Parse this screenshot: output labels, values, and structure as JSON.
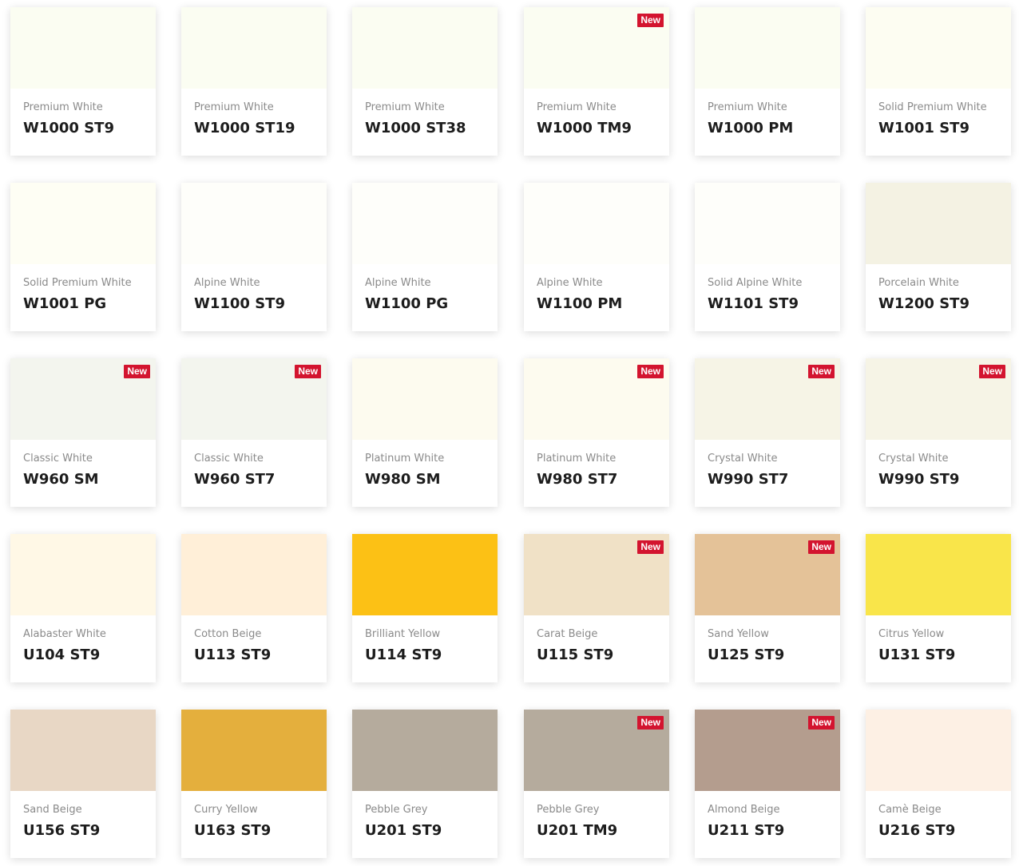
{
  "badge_label": "New",
  "cards": [
    {
      "name": "Premium White",
      "code": "W1000 ST9",
      "color": "#fbfdf2",
      "is_new": false
    },
    {
      "name": "Premium White",
      "code": "W1000 ST19",
      "color": "#fbfdf2",
      "is_new": false
    },
    {
      "name": "Premium White",
      "code": "W1000 ST38",
      "color": "#fbfdf2",
      "is_new": false
    },
    {
      "name": "Premium White",
      "code": "W1000 TM9",
      "color": "#fbfdf2",
      "is_new": true
    },
    {
      "name": "Premium White",
      "code": "W1000 PM",
      "color": "#fbfdf2",
      "is_new": false
    },
    {
      "name": "Solid Premium White",
      "code": "W1001 ST9",
      "color": "#fdfdf2",
      "is_new": false
    },
    {
      "name": "Solid Premium White",
      "code": "W1001 PG",
      "color": "#fefef4",
      "is_new": false
    },
    {
      "name": "Alpine White",
      "code": "W1100 ST9",
      "color": "#fefefa",
      "is_new": false
    },
    {
      "name": "Alpine White",
      "code": "W1100 PG",
      "color": "#fefefa",
      "is_new": false
    },
    {
      "name": "Alpine White",
      "code": "W1100 PM",
      "color": "#fefefa",
      "is_new": false
    },
    {
      "name": "Solid Alpine White",
      "code": "W1101 ST9",
      "color": "#fefefa",
      "is_new": false
    },
    {
      "name": "Porcelain White",
      "code": "W1200 ST9",
      "color": "#f4f2e3",
      "is_new": false
    },
    {
      "name": "Classic White",
      "code": "W960 SM",
      "color": "#f3f5ee",
      "is_new": true
    },
    {
      "name": "Classic White",
      "code": "W960 ST7",
      "color": "#f3f5ee",
      "is_new": true
    },
    {
      "name": "Platinum White",
      "code": "W980 SM",
      "color": "#fdfbef",
      "is_new": false
    },
    {
      "name": "Platinum White",
      "code": "W980 ST7",
      "color": "#fdfbef",
      "is_new": true
    },
    {
      "name": "Crystal White",
      "code": "W990 ST7",
      "color": "#f6f4e6",
      "is_new": true
    },
    {
      "name": "Crystal White",
      "code": "W990 ST9",
      "color": "#f6f4e6",
      "is_new": true
    },
    {
      "name": "Alabaster White",
      "code": "U104 ST9",
      "color": "#fff8e6",
      "is_new": false
    },
    {
      "name": "Cotton Beige",
      "code": "U113 ST9",
      "color": "#ffefd8",
      "is_new": false
    },
    {
      "name": "Brilliant Yellow",
      "code": "U114 ST9",
      "color": "#fcc115",
      "is_new": false
    },
    {
      "name": "Carat Beige",
      "code": "U115 ST9",
      "color": "#f0e1c6",
      "is_new": true
    },
    {
      "name": "Sand Yellow",
      "code": "U125 ST9",
      "color": "#e4c298",
      "is_new": true
    },
    {
      "name": "Citrus Yellow",
      "code": "U131 ST9",
      "color": "#f9e54a",
      "is_new": false
    },
    {
      "name": "Sand Beige",
      "code": "U156 ST9",
      "color": "#e8d7c5",
      "is_new": false
    },
    {
      "name": "Curry Yellow",
      "code": "U163 ST9",
      "color": "#e4af3d",
      "is_new": false
    },
    {
      "name": "Pebble Grey",
      "code": "U201 ST9",
      "color": "#b5ab9d",
      "is_new": false
    },
    {
      "name": "Pebble Grey",
      "code": "U201 TM9",
      "color": "#b5ab9d",
      "is_new": true
    },
    {
      "name": "Almond Beige",
      "code": "U211 ST9",
      "color": "#b49d8e",
      "is_new": true
    },
    {
      "name": "Camè Beige",
      "code": "U216 ST9",
      "color": "#fdf0e4",
      "is_new": false
    }
  ]
}
